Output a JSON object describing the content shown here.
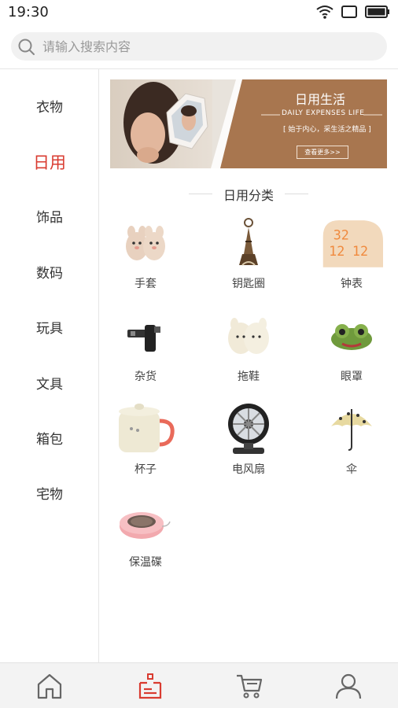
{
  "status": {
    "time": "19:30"
  },
  "search": {
    "placeholder": "请输入搜索内容"
  },
  "sidebar": {
    "items": [
      {
        "label": "衣物"
      },
      {
        "label": "日用"
      },
      {
        "label": "饰品"
      },
      {
        "label": "数码"
      },
      {
        "label": "玩具"
      },
      {
        "label": "文具"
      },
      {
        "label": "箱包"
      },
      {
        "label": "宅物"
      }
    ],
    "active": "日用"
  },
  "banner": {
    "title": "日用生活",
    "subtitle": "DAILY EXPENSES   LIFE",
    "slogan": "[ 始于内心，采生活之精品 ]",
    "button": "查看更多>>"
  },
  "section": {
    "title": "日用分类"
  },
  "categories": [
    {
      "label": "手套",
      "icon": "gloves-icon"
    },
    {
      "label": "钥匙圈",
      "icon": "keychain-icon"
    },
    {
      "label": "钟表",
      "icon": "clock-icon"
    },
    {
      "label": "杂货",
      "icon": "groceries-icon"
    },
    {
      "label": "拖鞋",
      "icon": "slippers-icon"
    },
    {
      "label": "眼罩",
      "icon": "eye-mask-icon"
    },
    {
      "label": "杯子",
      "icon": "cup-icon"
    },
    {
      "label": "电风扇",
      "icon": "fan-icon"
    },
    {
      "label": "伞",
      "icon": "umbrella-icon"
    },
    {
      "label": "保温碟",
      "icon": "warmer-plate-icon"
    }
  ],
  "bottom_nav": [
    {
      "name": "home-icon"
    },
    {
      "name": "category-icon",
      "active": true
    },
    {
      "name": "cart-icon"
    },
    {
      "name": "profile-icon"
    }
  ],
  "colors": {
    "accent": "#d93b30",
    "banner": "#a8764f"
  }
}
